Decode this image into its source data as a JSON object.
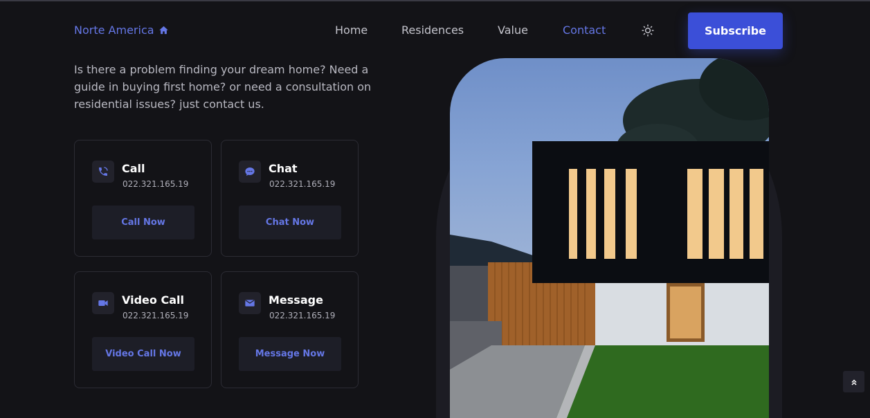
{
  "brand": {
    "name": "Norte America",
    "icon": "home-icon",
    "color": "#6577e6"
  },
  "nav": {
    "items": [
      {
        "label": "Home",
        "active": false
      },
      {
        "label": "Residences",
        "active": false
      },
      {
        "label": "Value",
        "active": false
      },
      {
        "label": "Contact",
        "active": true
      }
    ],
    "theme_icon": "sun-icon",
    "subscribe_label": "Subscribe"
  },
  "intro": {
    "text": "Is there a problem finding your dream home? Need a guide in buying first home? or need a consultation on residential issues? just contact us."
  },
  "contacts": [
    {
      "icon": "phone-icon",
      "title": "Call",
      "number": "022.321.165.19",
      "button": "Call Now"
    },
    {
      "icon": "chat-icon",
      "title": "Chat",
      "number": "022.321.165.19",
      "button": "Chat Now"
    },
    {
      "icon": "video-camera-icon",
      "title": "Video Call",
      "number": "022.321.165.19",
      "button": "Video Call Now"
    },
    {
      "icon": "mail-icon",
      "title": "Message",
      "number": "022.321.165.19",
      "button": "Message Now"
    }
  ],
  "colors": {
    "accent": "#6577e6",
    "button_bg": "#3b4fd8",
    "page_bg": "#131317"
  },
  "scroll_top_icon": "chevrons-up-icon"
}
